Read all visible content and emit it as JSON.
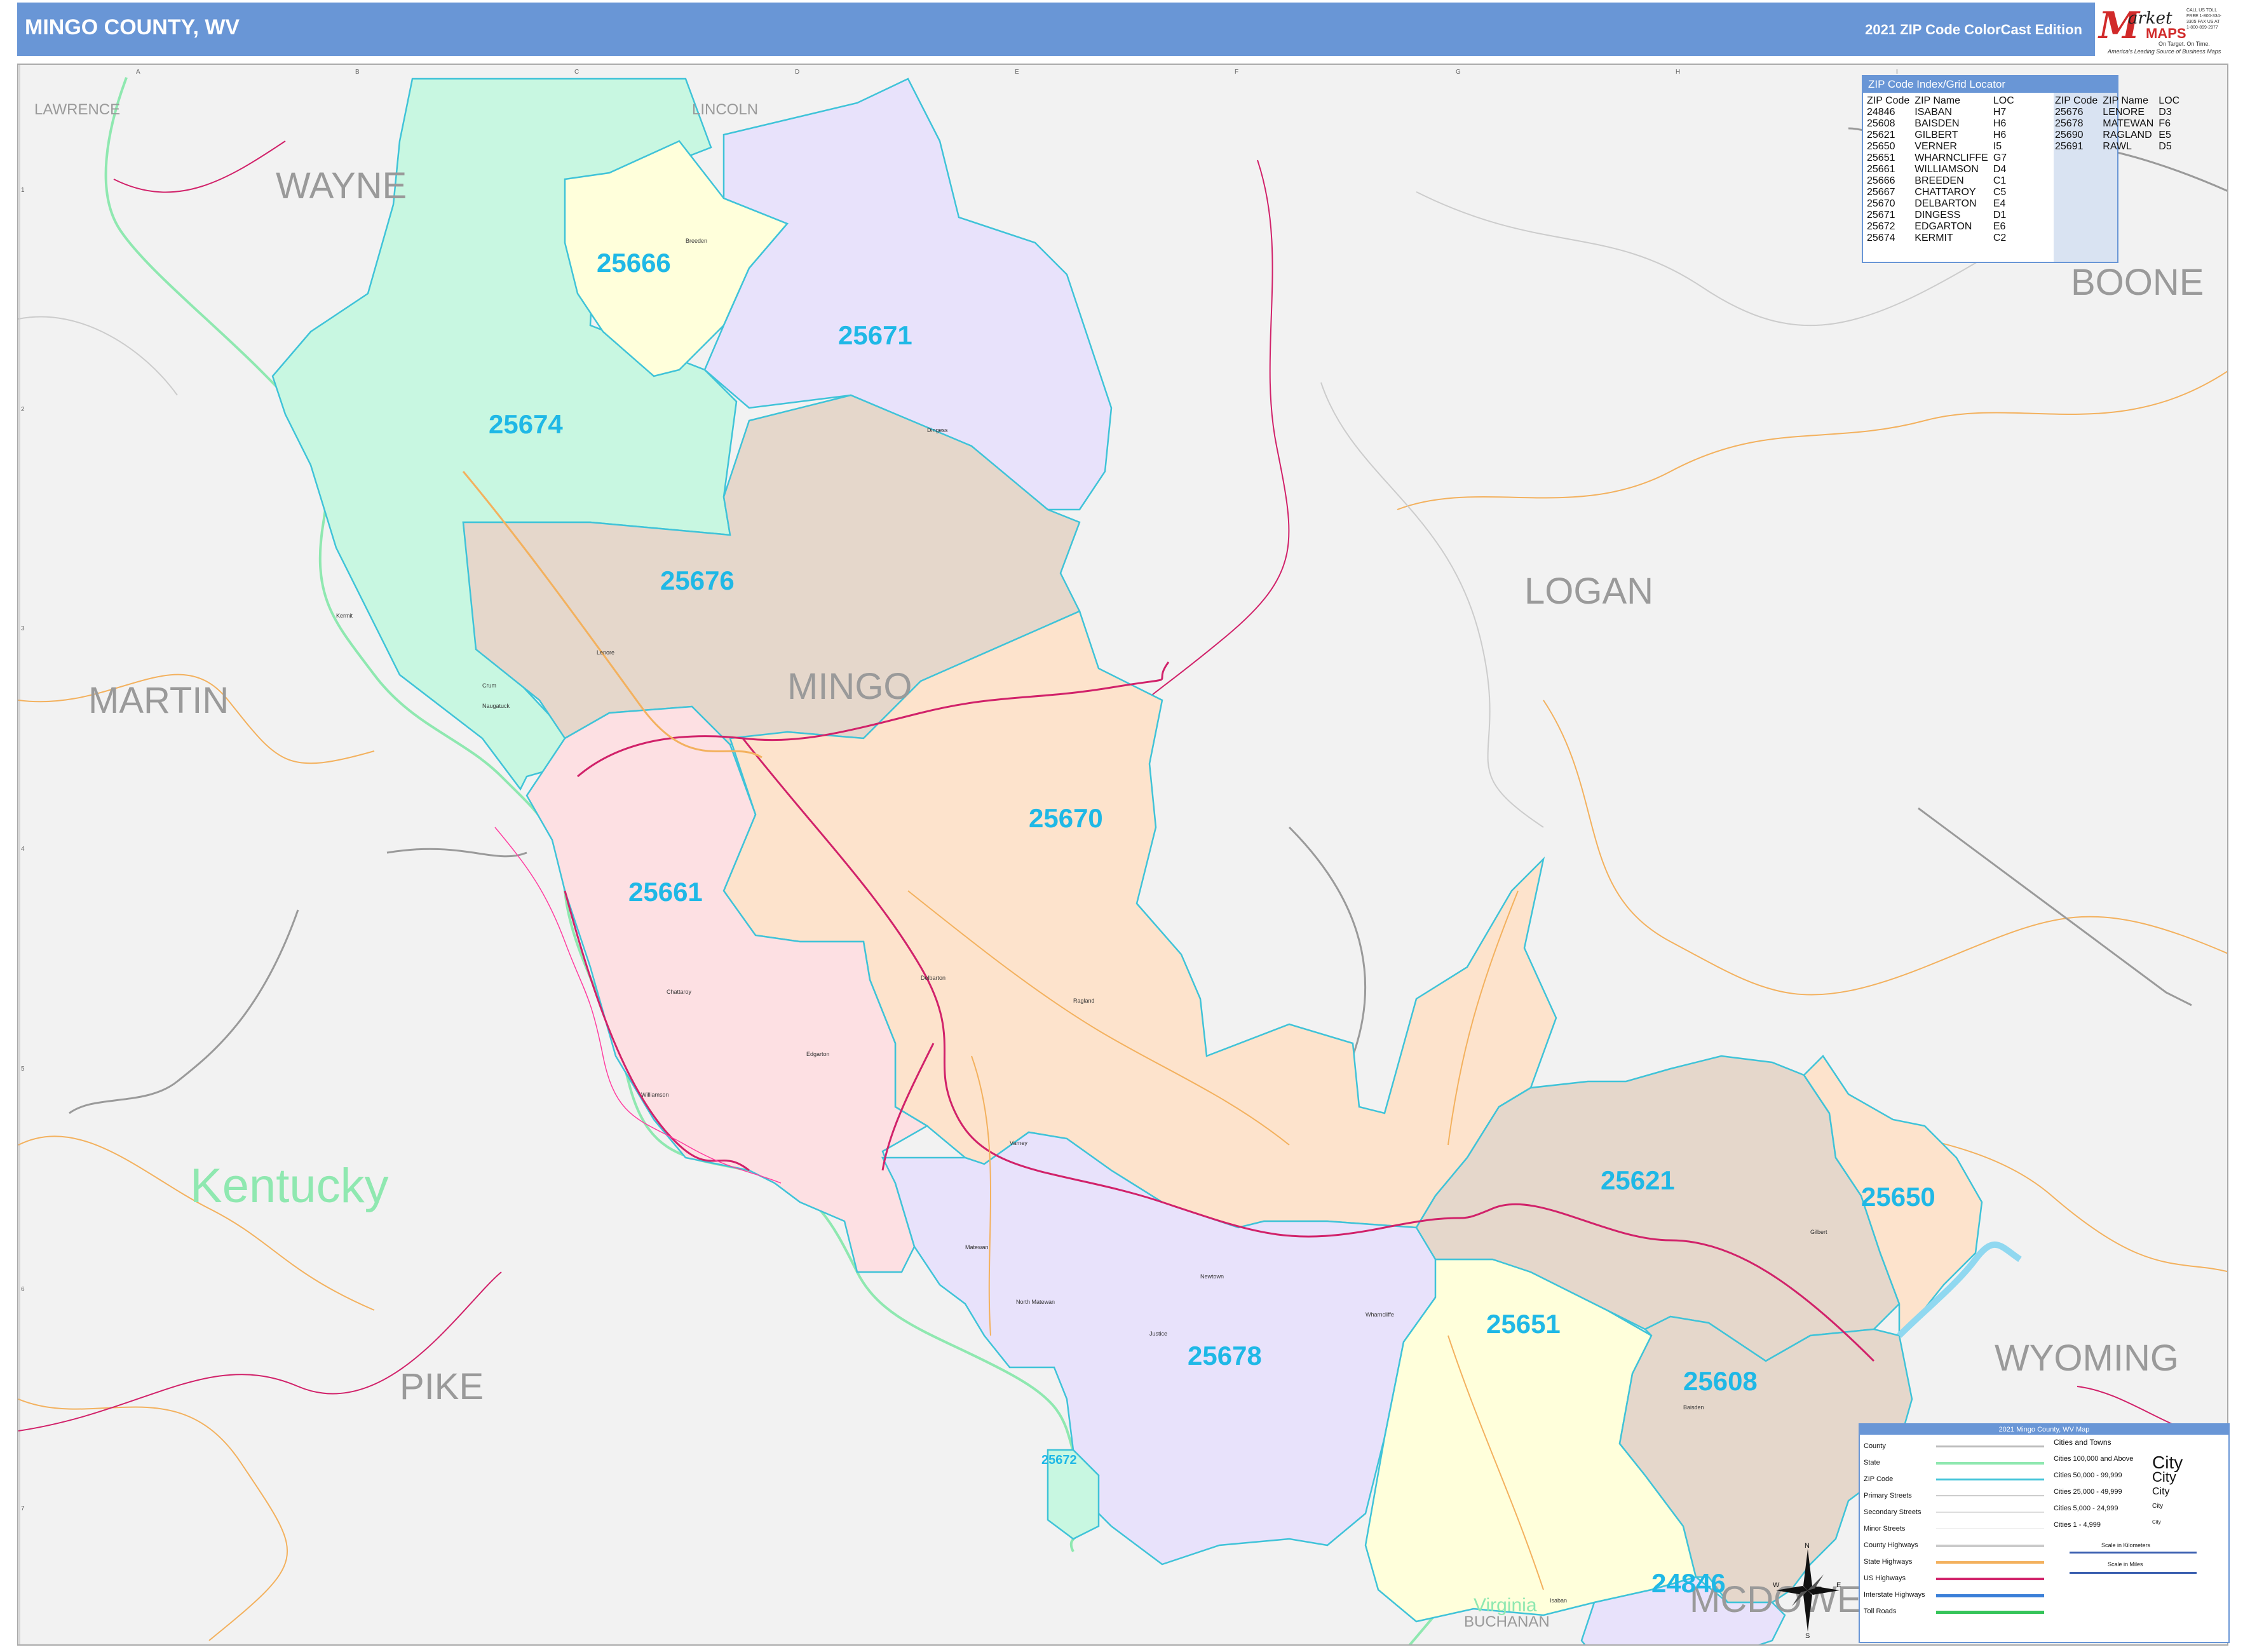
{
  "header": {
    "title": "MINGO COUNTY, WV",
    "edition": "2021 ZIP Code ColorCast Edition",
    "logo": {
      "m": "M",
      "arket": "arket",
      "maps": "MAPS",
      "tagline1": "On Target. On Time.",
      "tagline2": "America's Leading Source of Business Maps",
      "contact": "CALL US TOLL FREE 1-800-334-3305 FAX US AT 1-800-899-2977"
    }
  },
  "grid": {
    "columns": [
      "A",
      "B",
      "C",
      "D",
      "E",
      "F",
      "G",
      "H",
      "I"
    ],
    "rows": [
      "1",
      "2",
      "3",
      "4",
      "5",
      "6",
      "7"
    ]
  },
  "counties": {
    "wayne": "WAYNE",
    "lincoln": "LINCOLN",
    "lawrence": "LAWRENCE",
    "boone": "BOONE",
    "logan": "LOGAN",
    "mingo": "MINGO",
    "martin": "MARTIN",
    "wyoming": "WYOMING",
    "pike": "PIKE",
    "buchanan": "BUCHANAN",
    "mcdowell": "MCDOWELL"
  },
  "states": {
    "kentucky": "Kentucky",
    "virginia": "Virginia"
  },
  "zip_labels": [
    "25666",
    "25671",
    "25674",
    "25676",
    "25670",
    "25661",
    "25621",
    "25650",
    "25651",
    "25608",
    "25678",
    "25672",
    "24846"
  ],
  "towns": [
    "Breeden",
    "Dingess",
    "Kermit",
    "Crum",
    "Lenore",
    "Naugatuck",
    "Varney",
    "Delbarton",
    "Chattaroy",
    "Williamson",
    "Matewan",
    "Gilbert",
    "Baisden",
    "Isaban",
    "Newtown",
    "Wharncliffe",
    "Ragland",
    "North Matewan",
    "Justice",
    "Edgarton"
  ],
  "zip_index": {
    "title": "ZIP Code Index/Grid Locator",
    "headers": [
      "ZIP Code",
      "ZIP Name",
      "LOC"
    ],
    "left": [
      [
        "24846",
        "ISABAN",
        "H7"
      ],
      [
        "25608",
        "BAISDEN",
        "H6"
      ],
      [
        "25621",
        "GILBERT",
        "H6"
      ],
      [
        "25650",
        "VERNER",
        "I5"
      ],
      [
        "25651",
        "WHARNCLIFFE",
        "G7"
      ],
      [
        "25661",
        "WILLIAMSON",
        "D4"
      ],
      [
        "25666",
        "BREEDEN",
        "C1"
      ],
      [
        "25667",
        "CHATTAROY",
        "C5"
      ],
      [
        "25670",
        "DELBARTON",
        "E4"
      ],
      [
        "25671",
        "DINGESS",
        "D1"
      ],
      [
        "25672",
        "EDGARTON",
        "E6"
      ],
      [
        "25674",
        "KERMIT",
        "C2"
      ]
    ],
    "right": [
      [
        "25676",
        "LENORE",
        "D3"
      ],
      [
        "25678",
        "MATEWAN",
        "F6"
      ],
      [
        "25690",
        "RAGLAND",
        "E5"
      ],
      [
        "25691",
        "RAWL",
        "D5"
      ]
    ]
  },
  "legend": {
    "title": "2021 Mingo County, WV Map",
    "items": [
      "County",
      "State",
      "ZIP Code",
      "Primary Streets",
      "Secondary Streets",
      "Minor Streets",
      "County Highways",
      "State Highways",
      "US Highways",
      "Interstate Highways",
      "Toll Roads"
    ],
    "cities_title": "Cities and Towns",
    "cities": [
      "Cities 100,000 and Above",
      "Cities 50,000 - 99,999",
      "Cities 25,000 - 49,999",
      "Cities 5,000 - 24,999",
      "Cities 1 - 4,999"
    ],
    "city_example": "City",
    "scale_km": "Scale in Kilometers",
    "scale_mi": "Scale in Miles"
  },
  "compass": {
    "n": "N",
    "s": "S",
    "e": "E",
    "w": "W"
  },
  "colors": {
    "header": "#6996d6",
    "zip_label": "#1fb8e6",
    "zip_boundary": "#3fc3d8",
    "mint": "#c8f7e1",
    "lightyellow": "#ffffdb",
    "lavender": "#e8e2fb",
    "taupe": "#e5d7cb",
    "peach": "#fde3cc",
    "pink": "#fde0e3",
    "state_line": "#8fe8b0",
    "highway_red": "#d1226a",
    "road_orange": "#f3b15e"
  }
}
